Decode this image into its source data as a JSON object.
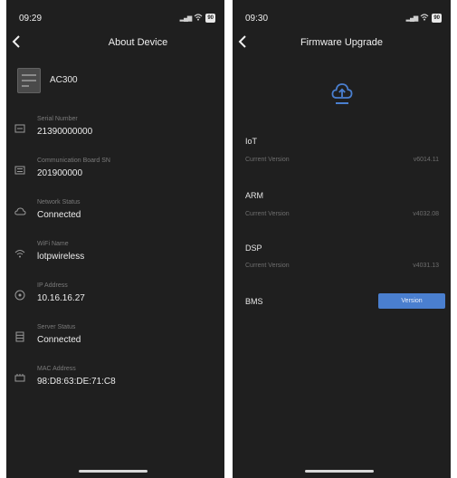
{
  "left": {
    "status": {
      "time": "09:29",
      "battery": "90"
    },
    "title": "About Device",
    "device": {
      "name": "AC300"
    },
    "items": [
      {
        "label": "Serial Number",
        "value": "21390000000"
      },
      {
        "label": "Communication Board SN",
        "value": "201900000"
      },
      {
        "label": "Network Status",
        "value": "Connected"
      },
      {
        "label": "WiFi Name",
        "value": "lotpwireless"
      },
      {
        "label": "IP Address",
        "value": "10.16.16.27"
      },
      {
        "label": "Server Status",
        "value": "Connected"
      },
      {
        "label": "MAC Address",
        "value": "98:D8:63:DE:71:C8"
      }
    ]
  },
  "right": {
    "status": {
      "time": "09:30",
      "battery": "90"
    },
    "title": "Firmware Upgrade",
    "modules": [
      {
        "name": "IoT",
        "label": "Current Version",
        "version": "v6014.11"
      },
      {
        "name": "ARM",
        "label": "Current Version",
        "version": "v4032.08"
      },
      {
        "name": "DSP",
        "label": "Current Version",
        "version": "v4031.13"
      }
    ],
    "bms": {
      "name": "BMS",
      "button": "Version"
    }
  },
  "colors": {
    "background": "#1f1f1f",
    "accent": "#4a7fcf"
  }
}
